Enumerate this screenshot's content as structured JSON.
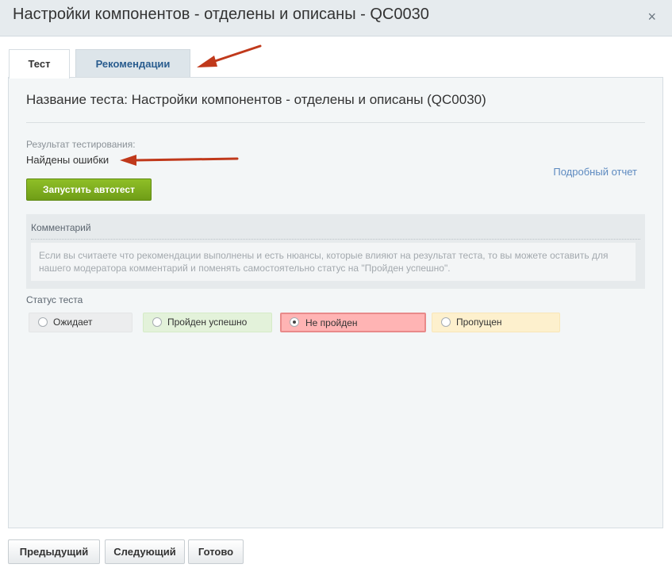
{
  "window": {
    "title": "Настройки компонентов - отделены и описаны - QC0030",
    "close_glyph": "×"
  },
  "tabs": [
    {
      "label": "Тест",
      "active": true
    },
    {
      "label": "Рекомендации",
      "active": false
    }
  ],
  "main": {
    "test_name": "Название теста: Настройки компонентов - отделены и описаны (QC0030)",
    "result_label": "Результат тестирования:",
    "result_value": "Найдены ошибки",
    "report_link": "Подробный отчет",
    "autotest_button": "Запустить автотест",
    "comment": {
      "title": "Комментарий",
      "placeholder": "Если вы считаете что рекомендации выполнены и есть нюансы, которые влияют на результат теста, то вы можете оставить для нашего модератора комментарий и поменять самостоятельно статус на \"Пройден успешно\"."
    },
    "status": {
      "label": "Статус теста",
      "options": [
        {
          "label": "Ожидает",
          "selected": false
        },
        {
          "label": "Пройден успешно",
          "selected": false
        },
        {
          "label": "Не пройден",
          "selected": true
        },
        {
          "label": "Пропущен",
          "selected": false
        }
      ]
    }
  },
  "footer": {
    "prev": "Предыдущий",
    "next": "Следующий",
    "done": "Готово"
  },
  "colors": {
    "accent_green": "#7aa91c",
    "fail_red": "#ffb4b4",
    "annotation_arrow": "#c0391b"
  }
}
